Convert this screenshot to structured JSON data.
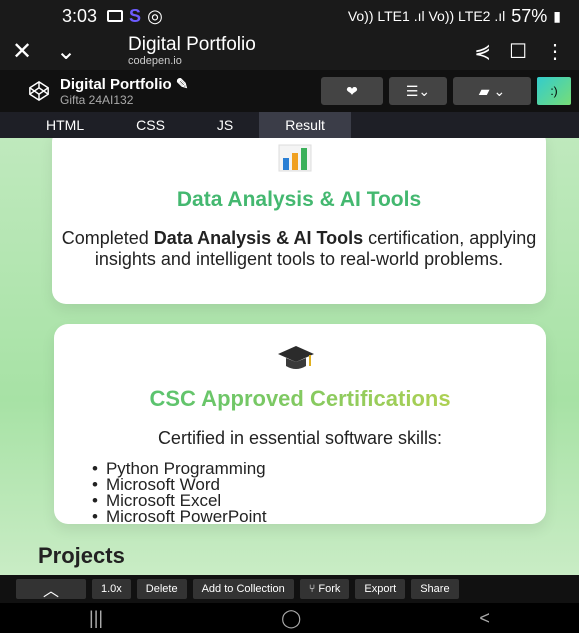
{
  "status": {
    "time": "3:03",
    "battery": "57%",
    "network": "Vo)) LTE1 .ıl Vo)) LTE2 .ıl"
  },
  "app_bar": {
    "title": "Digital Portfolio",
    "url": "codepen.io"
  },
  "codepen": {
    "pen_title": "Digital Portfolio",
    "pen_author": "Gifta 24AI132"
  },
  "tabs": [
    "HTML",
    "CSS",
    "JS",
    "Result"
  ],
  "cards": [
    {
      "heading": "Data Analysis & AI Tools",
      "desc_before": "Completed ",
      "desc_bold": "Data Analysis & AI Tools",
      "desc_after": " certification, applying insights and intelligent tools to real-world problems."
    },
    {
      "heading": "CSC Approved Certifications",
      "desc": "Certified in essential software skills:",
      "items": [
        "Python Programming",
        "Microsoft Word",
        "Microsoft Excel",
        "Microsoft PowerPoint"
      ]
    }
  ],
  "section_heading": "Projects",
  "toolbar": {
    "zoom": "1.0x",
    "delete": "Delete",
    "add_to_collection": "Add to Collection",
    "fork": "Fork",
    "export": "Export",
    "share": "Share"
  },
  "nav": {
    "recents": "|||",
    "home": "◯",
    "back": "<"
  }
}
